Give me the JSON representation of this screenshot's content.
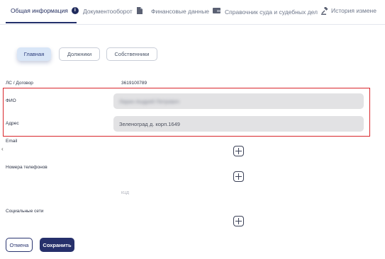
{
  "tabs": [
    {
      "label": "Общая информация",
      "icon": "info-icon"
    },
    {
      "label": "Документооборот",
      "icon": "document-icon"
    },
    {
      "label": "Финансовые данные",
      "icon": "wallet-icon"
    },
    {
      "label": "Справочник суда и судебных дел",
      "icon": "gavel-icon"
    },
    {
      "label": "История измене"
    }
  ],
  "subtabs": [
    "Главная",
    "Должники",
    "Собственники"
  ],
  "fields": {
    "account_label": "ЛС / Договор",
    "account_value": "3619100789",
    "fio_label": "ФИО",
    "fio_value": "Ларин Андрей Петрович",
    "address_label": "Адрес",
    "address_value": "Зеленоград д. корп.1649",
    "email_label": "Email",
    "phones_label": "Номера телефонов",
    "phones_hint": "КЦД",
    "social_label": "Социальные сети"
  },
  "buttons": {
    "cancel": "Отмена",
    "save": "Сохранить"
  },
  "colors": {
    "accent": "#23306b",
    "highlight": "#d9262b",
    "field_bg": "#e2e2e4"
  }
}
